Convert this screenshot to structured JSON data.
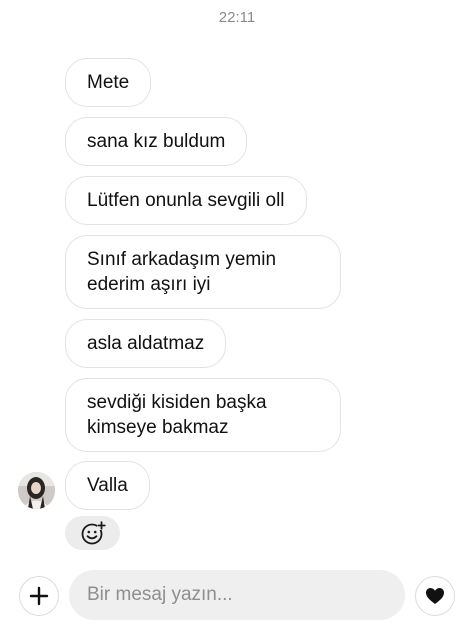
{
  "chat": {
    "timestamp": "22:11",
    "messages": [
      {
        "text": "Mete"
      },
      {
        "text": "sana kız buldum"
      },
      {
        "text": "Lütfen onunla sevgili oll"
      },
      {
        "text": "Sınıf arkadaşım yemin ederim aşırı iyi"
      },
      {
        "text": "asla aldatmaz"
      },
      {
        "text": "sevdiği kisiden başka kimseye bakmaz"
      },
      {
        "text": "Valla"
      }
    ],
    "reaction_icon": "add-reaction-smiley-icon"
  },
  "composer": {
    "placeholder": "Bir mesaj yazın...",
    "plus_icon": "plus-icon",
    "heart_icon": "heart-icon"
  },
  "colors": {
    "bubble_border": "#e3e3e3",
    "input_background": "#efefef",
    "timestamp": "#8a8a8a",
    "text": "#111111"
  }
}
